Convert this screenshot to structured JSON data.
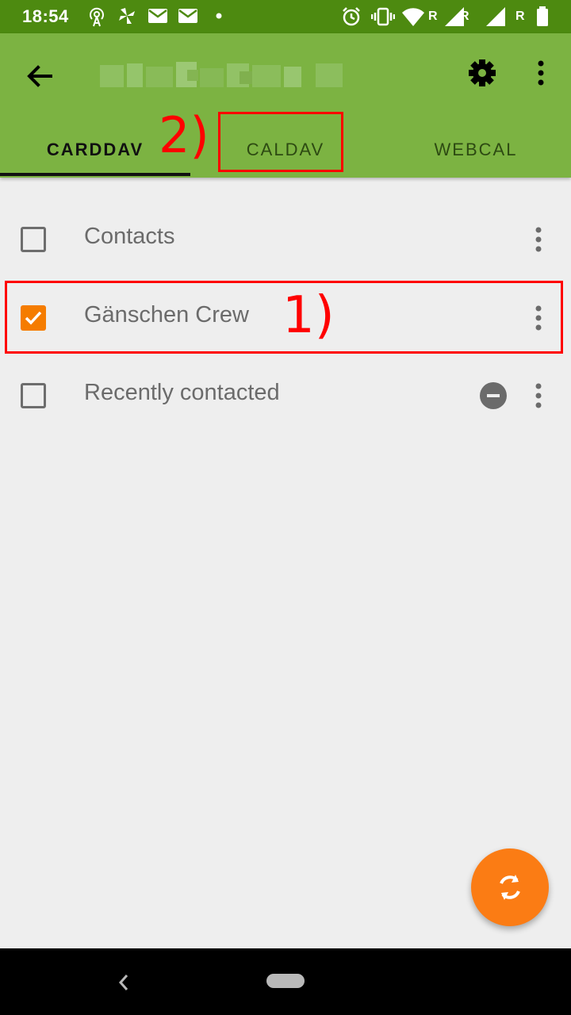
{
  "status_bar": {
    "time": "18:54",
    "background": "#4d8a10",
    "left_icons": [
      "hotspot-icon",
      "pinwheel-icon",
      "mail-icon",
      "mail-icon",
      "dot-icon"
    ],
    "right_icons": [
      "alarm-icon",
      "vibrate-icon",
      "wifi-icon",
      "signal-icon",
      "signal-icon",
      "battery-icon"
    ],
    "roaming_label_1": "R",
    "roaming_label_2": "R"
  },
  "app_bar": {
    "background": "#7cb342",
    "back_icon": "arrow-back-icon",
    "settings_icon": "gear-icon",
    "menu_icon": "more-vert-icon"
  },
  "tabs": [
    {
      "label": "CARDDAV",
      "selected": true
    },
    {
      "label": "CALDAV",
      "selected": false
    },
    {
      "label": "WEBCAL",
      "selected": false
    }
  ],
  "list": {
    "rows": [
      {
        "label": "Contacts",
        "checked": false
      },
      {
        "label": "Gänschen Crew",
        "checked": true
      },
      {
        "label": "Recently contacted",
        "checked": false,
        "remove_icon": "remove-circle-icon"
      }
    ],
    "checkbox_accent": "#f57c00"
  },
  "annotations": {
    "label_1": "1)",
    "label_2": "2)",
    "color": "#ff0000"
  },
  "fab": {
    "icon": "sync-icon",
    "color": "#fb7c14"
  },
  "nav_bar": {
    "back_icon": "nav-back-icon",
    "home_icon": "nav-home-pill"
  }
}
